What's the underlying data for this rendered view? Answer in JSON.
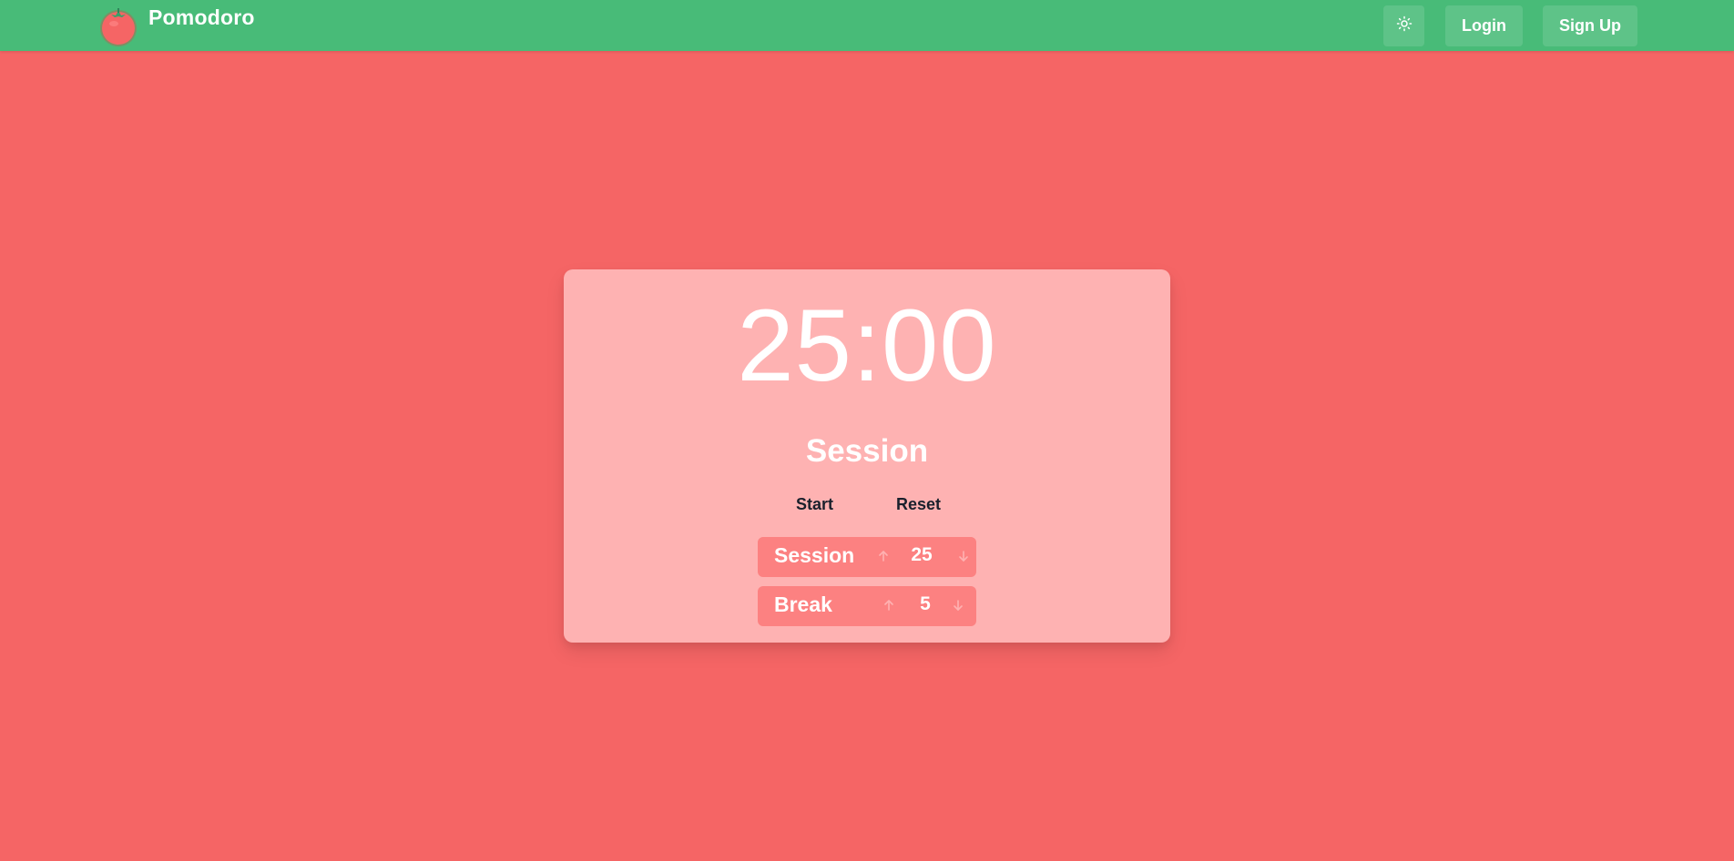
{
  "navbar": {
    "brand_title": "Pomodoro",
    "logo_icon": "tomato-icon",
    "theme_icon": "sun-icon",
    "login_label": "Login",
    "signup_label": "Sign Up",
    "background_color": "#48bb78"
  },
  "page": {
    "background_color": "#f56565"
  },
  "timer": {
    "display": "25:00",
    "mode_label": "Session",
    "start_label": "Start",
    "reset_label": "Reset",
    "card_color": "#feb2b2"
  },
  "settings": {
    "session": {
      "label": "Session",
      "value": "25",
      "increment_icon": "arrow-up-icon",
      "decrement_icon": "arrow-down-icon"
    },
    "break": {
      "label": "Break",
      "value": "5",
      "increment_icon": "arrow-up-icon",
      "decrement_icon": "arrow-down-icon"
    },
    "row_color": "#fc8181"
  }
}
